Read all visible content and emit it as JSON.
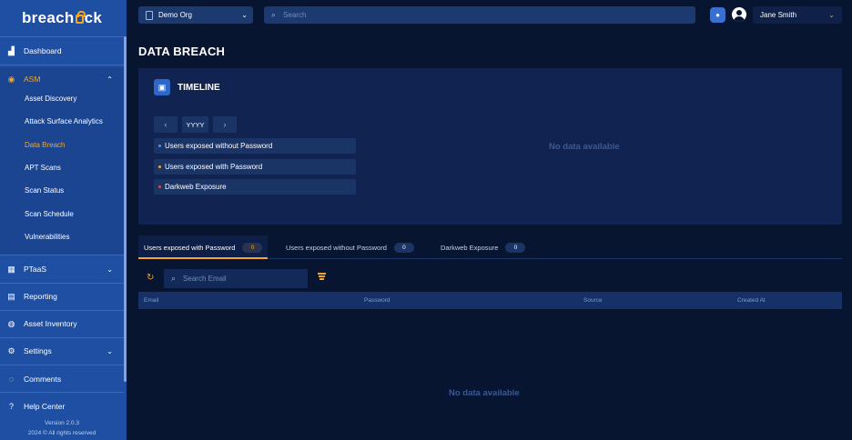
{
  "brand": {
    "logo_text_a": "breach",
    "logo_text_b": "ck"
  },
  "sidebar": {
    "items": [
      {
        "label": "Dashboard",
        "icon": "chart-bar-icon"
      },
      {
        "label": "ASM",
        "icon": "target-icon"
      },
      {
        "label": "PTaaS",
        "icon": "grid-icon"
      },
      {
        "label": "Reporting",
        "icon": "report-icon"
      },
      {
        "label": "Asset Inventory",
        "icon": "inventory-icon"
      },
      {
        "label": "Settings",
        "icon": "gear-icon"
      },
      {
        "label": "Comments",
        "icon": "comment-icon"
      },
      {
        "label": "Help Center",
        "icon": "help-icon"
      }
    ],
    "asm_sub": [
      "Asset Discovery",
      "Attack Surface Analytics",
      "Data Breach",
      "APT Scans",
      "Scan Status",
      "Scan Schedule",
      "Vulnerabilities"
    ],
    "version": "Version 2.0.3",
    "copyright": "2024 © All rights reserved"
  },
  "topbar": {
    "org": "Demo Org",
    "search_placeholder": "Search",
    "user_name": "Jane Smith"
  },
  "page": {
    "title": "DATA BREACH",
    "timeline": {
      "title": "TIMELINE",
      "year": "YYYY",
      "legend": [
        {
          "label": "Users exposed without Password",
          "color": "#5b8def"
        },
        {
          "label": "Users exposed with Password",
          "color": "#f5a623"
        },
        {
          "label": "Darkweb Exposure",
          "color": "#e04a4a"
        }
      ],
      "no_data": "No data available"
    },
    "tabs": [
      {
        "label": "Users exposed with Password",
        "count": "0"
      },
      {
        "label": "Users exposed without Password",
        "count": "0"
      },
      {
        "label": "Darkweb Exposure",
        "count": "0"
      }
    ],
    "email_search_placeholder": "Search Email",
    "table": {
      "columns": [
        "Email",
        "Password",
        "Source",
        "Created At"
      ],
      "no_data": "No data available"
    }
  },
  "colors": {
    "accent": "#f5a623",
    "sidebar": "#1f4fa3",
    "background": "#081530"
  }
}
